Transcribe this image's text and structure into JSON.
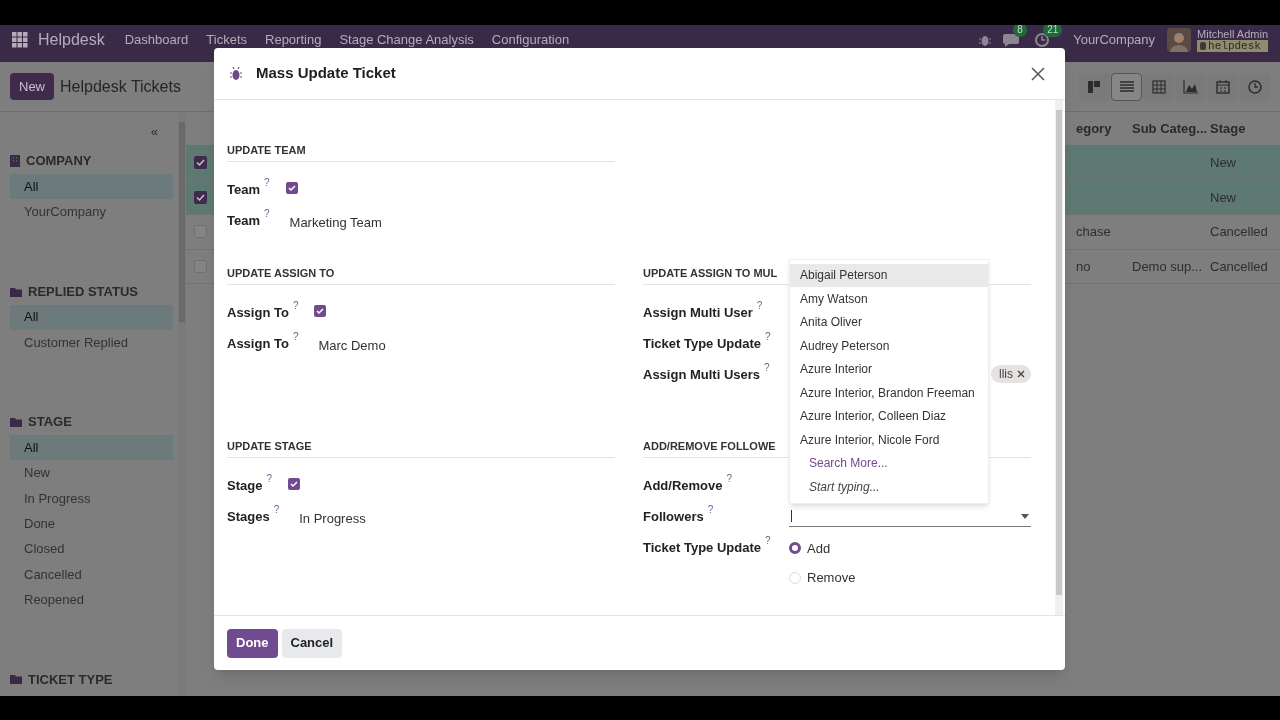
{
  "navbar": {
    "app": "Helpdesk",
    "menu": [
      "Dashboard",
      "Tickets",
      "Reporting",
      "Stage Change Analysis",
      "Configuration"
    ],
    "chat_count": "8",
    "activity_count": "21",
    "company": "YourCompany",
    "user": "Mitchell Admin",
    "database": "helpdesk"
  },
  "control_panel": {
    "new_button": "New",
    "title": "Helpdesk Tickets",
    "views": [
      {
        "kind": "kanban",
        "selected": false
      },
      {
        "kind": "list",
        "selected": true
      },
      {
        "kind": "pivot",
        "selected": false
      },
      {
        "kind": "graph",
        "selected": false
      },
      {
        "kind": "calendar",
        "selected": false
      },
      {
        "kind": "activity",
        "selected": false
      }
    ]
  },
  "sidebar": {
    "collapse": "«",
    "sections": [
      {
        "kind": "company",
        "title": "COMPANY",
        "items": [
          {
            "label": "All",
            "selected": true
          },
          {
            "label": "YourCompany",
            "selected": false
          }
        ]
      },
      {
        "kind": "folder",
        "title": "REPLIED STATUS",
        "items": [
          {
            "label": "All",
            "selected": true
          },
          {
            "label": "Customer Replied",
            "selected": false
          }
        ]
      },
      {
        "kind": "folder",
        "title": "STAGE",
        "items": [
          {
            "label": "All",
            "selected": true
          },
          {
            "label": "New",
            "selected": false
          },
          {
            "label": "In Progress",
            "selected": false
          },
          {
            "label": "Done",
            "selected": false
          },
          {
            "label": "Closed",
            "selected": false
          },
          {
            "label": "Cancelled",
            "selected": false
          },
          {
            "label": "Reopened",
            "selected": false
          }
        ]
      },
      {
        "kind": "folder",
        "title": "TICKET TYPE"
      }
    ]
  },
  "table": {
    "columns": [
      "egory",
      "Sub Categ...",
      "Stage"
    ],
    "rows": [
      {
        "selected": true,
        "cells": [
          "",
          "",
          "New"
        ]
      },
      {
        "selected": true,
        "cells": [
          "",
          "",
          "New"
        ]
      },
      {
        "selected": false,
        "cells": [
          "chase",
          "",
          "Cancelled"
        ]
      },
      {
        "selected": false,
        "cells": [
          "no",
          "Demo sup...",
          "Cancelled"
        ]
      }
    ]
  },
  "dialog": {
    "title": "Mass Update Ticket",
    "rows": [
      [
        {
          "heading": "UPDATE TEAM",
          "fields": [
            {
              "label": "Team",
              "help": "?",
              "kind": "checkbox",
              "checked": true
            },
            {
              "label": "Team",
              "help": "?",
              "kind": "text",
              "value": "Marketing Team"
            }
          ]
        }
      ],
      [
        {
          "heading": "UPDATE ASSIGN TO",
          "fields": [
            {
              "label": "Assign To",
              "help": "?",
              "kind": "checkbox",
              "checked": true
            },
            {
              "label": "Assign To",
              "help": "?",
              "kind": "text",
              "value": "Marc Demo"
            }
          ]
        },
        {
          "heading": "UPDATE ASSIGN TO MUL",
          "fields": [
            {
              "label": "Assign Multi User",
              "help": "?",
              "kind": "label"
            },
            {
              "label": "Ticket Type Update",
              "help": "?",
              "kind": "label"
            },
            {
              "label": "Assign Multi Users",
              "help": "?",
              "kind": "tags",
              "tags": [
                "llis"
              ]
            }
          ]
        }
      ],
      [
        {
          "heading": "UPDATE STAGE",
          "fields": [
            {
              "label": "Stage",
              "help": "?",
              "kind": "checkbox",
              "checked": true
            },
            {
              "label": "Stages",
              "help": "?",
              "kind": "text",
              "value": "In Progress"
            }
          ]
        },
        {
          "heading": "ADD/REMOVE FOLLOWE",
          "fields": [
            {
              "label": "Add/Remove",
              "help": "?",
              "kind": "label"
            },
            {
              "label": "Followers",
              "help": "?",
              "kind": "input"
            },
            {
              "label": "Ticket Type Update",
              "help": "?",
              "kind": "radio",
              "options": [
                {
                  "label": "Add",
                  "selected": true
                },
                {
                  "label": "Remove",
                  "selected": false
                }
              ]
            }
          ]
        }
      ]
    ],
    "dropdown": {
      "items": [
        {
          "label": "Abigail Peterson",
          "selected": true
        },
        {
          "label": "Amy Watson",
          "selected": false
        },
        {
          "label": "Anita Oliver",
          "selected": false
        },
        {
          "label": "Audrey Peterson",
          "selected": false
        },
        {
          "label": "Azure Interior",
          "selected": false
        },
        {
          "label": "Azure Interior, Brandon Freeman",
          "selected": false
        },
        {
          "label": "Azure Interior, Colleen Diaz",
          "selected": false
        },
        {
          "label": "Azure Interior, Nicole Ford",
          "selected": false
        }
      ],
      "search_more": "Search More...",
      "hint": "Start typing..."
    },
    "buttons": [
      {
        "label": "Done",
        "kind": "primary"
      },
      {
        "label": "Cancel",
        "kind": "secondary"
      }
    ]
  }
}
